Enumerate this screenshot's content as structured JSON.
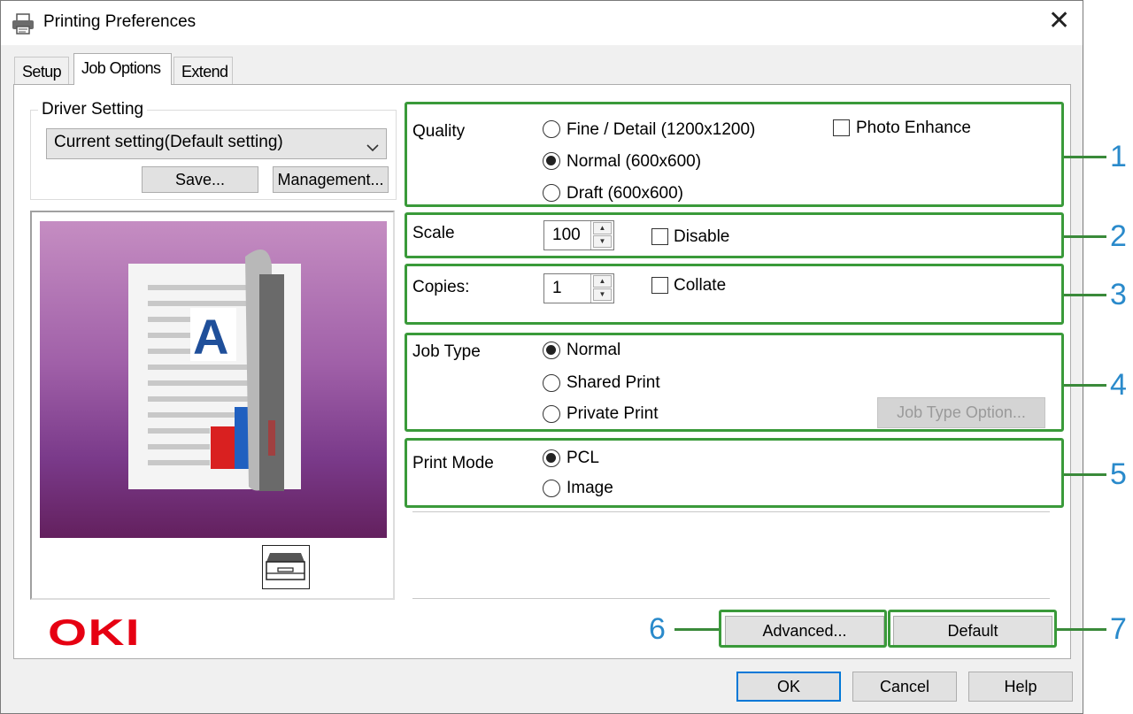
{
  "window": {
    "title": "Printing Preferences"
  },
  "tabs": [
    {
      "label": "Setup"
    },
    {
      "label": "Job Options"
    },
    {
      "label": "Extend"
    }
  ],
  "driver_setting": {
    "title": "Driver Setting",
    "combo_value": "Current setting(Default setting)",
    "save_label": "Save...",
    "management_label": "Management..."
  },
  "preview": {
    "letter": "A"
  },
  "brand": {
    "logo_text": "OKI",
    "logo_color": "#e60012"
  },
  "quality": {
    "label": "Quality",
    "options": [
      {
        "label": "Fine / Detail (1200x1200)",
        "selected": false
      },
      {
        "label": "Normal (600x600)",
        "selected": true
      },
      {
        "label": "Draft (600x600)",
        "selected": false
      }
    ],
    "photo_enhance_label": "Photo Enhance",
    "photo_enhance_checked": false
  },
  "scale": {
    "label": "Scale",
    "value": "100",
    "disable_label": "Disable",
    "disable_checked": false
  },
  "copies": {
    "label": "Copies:",
    "value": "1",
    "collate_label": "Collate",
    "collate_checked": false
  },
  "job_type": {
    "label": "Job Type",
    "options": [
      {
        "label": "Normal",
        "selected": true
      },
      {
        "label": "Shared Print",
        "selected": false
      },
      {
        "label": "Private Print",
        "selected": false
      }
    ],
    "option_button_label": "Job Type Option..."
  },
  "print_mode": {
    "label": "Print Mode",
    "options": [
      {
        "label": "PCL",
        "selected": true
      },
      {
        "label": "Image",
        "selected": false
      }
    ]
  },
  "buttons": {
    "advanced_label": "Advanced...",
    "default_label": "Default",
    "ok_label": "OK",
    "cancel_label": "Cancel",
    "help_label": "Help"
  },
  "callouts": [
    "1",
    "2",
    "3",
    "4",
    "5",
    "6",
    "7"
  ],
  "colors": {
    "highlight": "#3a9a3a",
    "callout_number": "#2a8acb",
    "ok_border": "#0078d7"
  }
}
